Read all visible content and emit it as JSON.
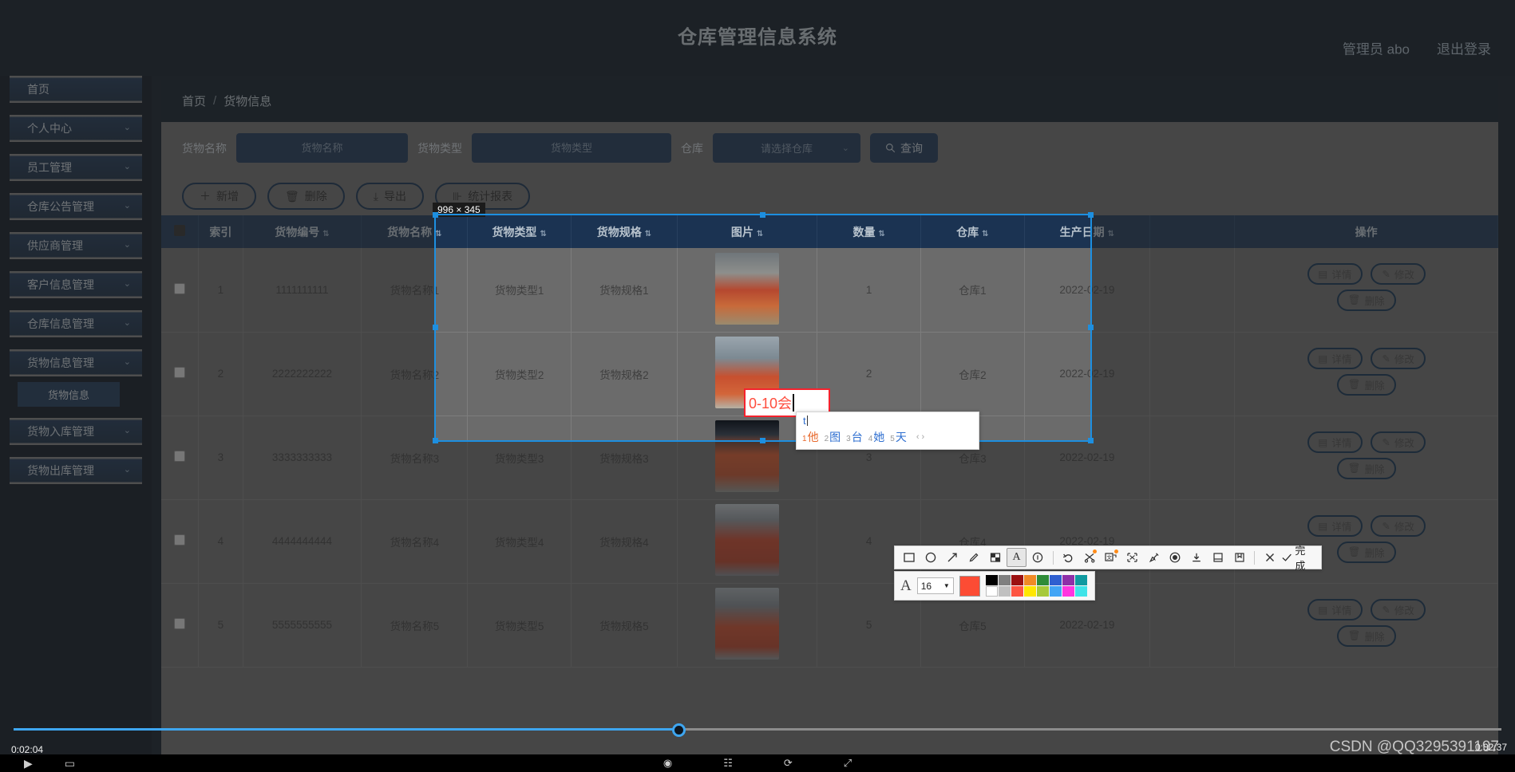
{
  "header": {
    "title": "仓库管理信息系统",
    "user_label": "管理员 abo",
    "logout_label": "退出登录"
  },
  "sidebar": {
    "items": [
      {
        "label": "首页",
        "expandable": false
      },
      {
        "label": "个人中心",
        "expandable": true
      },
      {
        "label": "员工管理",
        "expandable": true
      },
      {
        "label": "仓库公告管理",
        "expandable": true
      },
      {
        "label": "供应商管理",
        "expandable": true
      },
      {
        "label": "客户信息管理",
        "expandable": true
      },
      {
        "label": "仓库信息管理",
        "expandable": true
      },
      {
        "label": "货物信息管理",
        "expandable": true
      },
      {
        "label": "货物入库管理",
        "expandable": true
      },
      {
        "label": "货物出库管理",
        "expandable": true
      }
    ],
    "sub_item": "货物信息"
  },
  "breadcrumb": {
    "home": "首页",
    "sep": "/",
    "current": "货物信息"
  },
  "filters": {
    "name_label": "货物名称",
    "name_placeholder": "货物名称",
    "name_value": "",
    "type_label": "货物类型",
    "type_placeholder": "货物类型",
    "type_value": "",
    "warehouse_label": "仓库",
    "warehouse_selected": "请选择仓库",
    "query_label": "查询",
    "query_icon": "search-icon"
  },
  "toolbar": {
    "add_label": "新增",
    "add_icon": "plus-icon",
    "delete_label": "删除",
    "delete_icon": "trash-icon",
    "export_label": "导出",
    "export_icon": "download-icon",
    "report_label": "统计报表",
    "report_icon": "bar-chart-icon"
  },
  "table": {
    "columns": [
      {
        "label": "",
        "sortable": false
      },
      {
        "label": "索引",
        "sortable": false
      },
      {
        "label": "货物编号",
        "sortable": true
      },
      {
        "label": "货物名称",
        "sortable": true
      },
      {
        "label": "货物类型",
        "sortable": true
      },
      {
        "label": "货物规格",
        "sortable": true
      },
      {
        "label": "图片",
        "sortable": true
      },
      {
        "label": "数量",
        "sortable": true
      },
      {
        "label": "仓库",
        "sortable": true
      },
      {
        "label": "生产日期",
        "sortable": true
      },
      {
        "label": "",
        "sortable": false
      },
      {
        "label": "操作",
        "sortable": false
      }
    ],
    "rows": [
      {
        "index": "1",
        "code": "1111111111",
        "name": "货物名称1",
        "type": "货物类型1",
        "spec": "货物规格1",
        "qty": "1",
        "warehouse": "仓库1",
        "date": "2022-02-19"
      },
      {
        "index": "2",
        "code": "2222222222",
        "name": "货物名称2",
        "type": "货物类型2",
        "spec": "货物规格2",
        "qty": "2",
        "warehouse": "仓库2",
        "date": "2022-02-19"
      },
      {
        "index": "3",
        "code": "3333333333",
        "name": "货物名称3",
        "type": "货物类型3",
        "spec": "货物规格3",
        "qty": "3",
        "warehouse": "仓库3",
        "date": "2022-02-19"
      },
      {
        "index": "4",
        "code": "4444444444",
        "name": "货物名称4",
        "type": "货物类型4",
        "spec": "货物规格4",
        "qty": "4",
        "warehouse": "仓库4",
        "date": "2022-02-19"
      },
      {
        "index": "5",
        "code": "5555555555",
        "name": "货物名称5",
        "type": "货物类型5",
        "spec": "货物规格5",
        "qty": "5",
        "warehouse": "仓库5",
        "date": "2022-02-19"
      }
    ],
    "row_actions": {
      "detail_label": "详情",
      "detail_icon": "document-icon",
      "edit_label": "修改",
      "edit_icon": "pencil-icon",
      "delete_label": "删除",
      "delete_icon": "trash-icon"
    }
  },
  "screenshot_tool": {
    "size_badge": "996 × 345",
    "annotation_text": "0-10会",
    "annotation_color": "#ff4d3d",
    "toolbar_icons": [
      "rectangle-icon",
      "ellipse-icon",
      "arrow-icon",
      "pencil-icon",
      "mosaic-icon",
      "text-icon",
      "serial-number-icon",
      "undo-icon",
      "cut-icon",
      "ocr-icon",
      "shape-recognize-icon",
      "pin-icon",
      "record-icon",
      "download-icon",
      "save-icon",
      "bookmark-icon",
      "close-icon",
      "check-icon"
    ],
    "done_label": "完成",
    "font_size": "16",
    "font_icon": "font-size-icon",
    "current_color": "#fc4c34",
    "palette_row1": [
      "#000000",
      "#808080",
      "#9b1111",
      "#f08a26",
      "#2e8b38",
      "#2f5fd0",
      "#8e2fa8",
      "#0f9aa0"
    ],
    "palette_row2": [
      "#ffffff",
      "#c0c0c0",
      "#fd5542",
      "#ffe600",
      "#a6c93a",
      "#42a5f5",
      "#ff35e0",
      "#3fe3e8"
    ]
  },
  "ime": {
    "typed": "t",
    "candidates": [
      {
        "num": "1",
        "text": "他"
      },
      {
        "num": "2",
        "text": "图"
      },
      {
        "num": "3",
        "text": "台"
      },
      {
        "num": "4",
        "text": "她"
      },
      {
        "num": "5",
        "text": "天"
      }
    ],
    "pager_prev": "‹",
    "pager_next": "›"
  },
  "player": {
    "time_current": "0:02:04",
    "time_total": "0:02:37",
    "progress_percent": 44.7,
    "watermark": "CSDN @QQ3295391197"
  }
}
